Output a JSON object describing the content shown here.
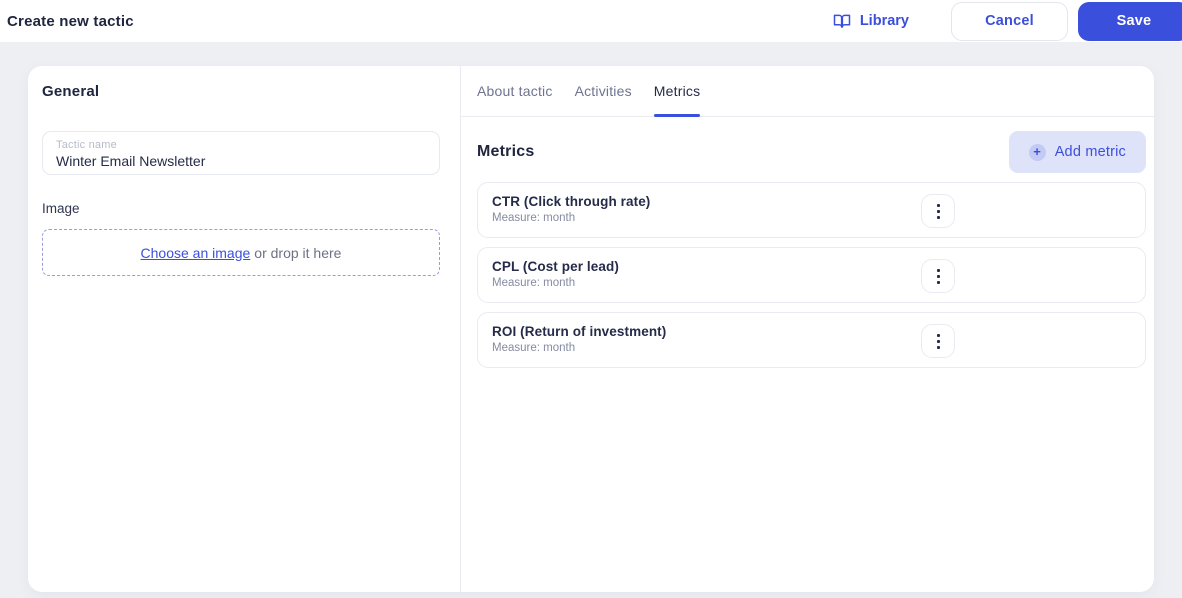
{
  "topbar": {
    "title": "Create new tactic",
    "library_label": "Library",
    "cancel_label": "Cancel",
    "save_label": "Save"
  },
  "general": {
    "heading": "General",
    "tactic_name_label": "Tactic name",
    "tactic_name_value": "Winter Email Newsletter",
    "image_label": "Image",
    "choose_image_link": "Choose an image",
    "drop_text": "or drop it here"
  },
  "tabs": [
    {
      "label": "About tactic",
      "active": false
    },
    {
      "label": "Activities",
      "active": false
    },
    {
      "label": "Metrics",
      "active": true
    }
  ],
  "metrics": {
    "heading": "Metrics",
    "add_button_label": "Add metric",
    "plus_glyph": "+",
    "items": [
      {
        "name": "CTR (Click through rate)",
        "measure": "Measure: month"
      },
      {
        "name": "CPL (Cost per lead)",
        "measure": "Measure: month"
      },
      {
        "name": "ROI (Return of investment)",
        "measure": "Measure: month"
      }
    ]
  },
  "icons": {
    "library": "book-open-icon",
    "add": "plus-icon",
    "card_menu": "kebab-menu-icon"
  },
  "colors": {
    "primary": "#3b4fdd",
    "dark_text": "#252b48",
    "muted_text": "#858ba1",
    "page_bg": "#edeff3",
    "add_metric_bg": "#dfe3fa",
    "border": "#e9ebf1",
    "dashed_border": "#979edb"
  }
}
